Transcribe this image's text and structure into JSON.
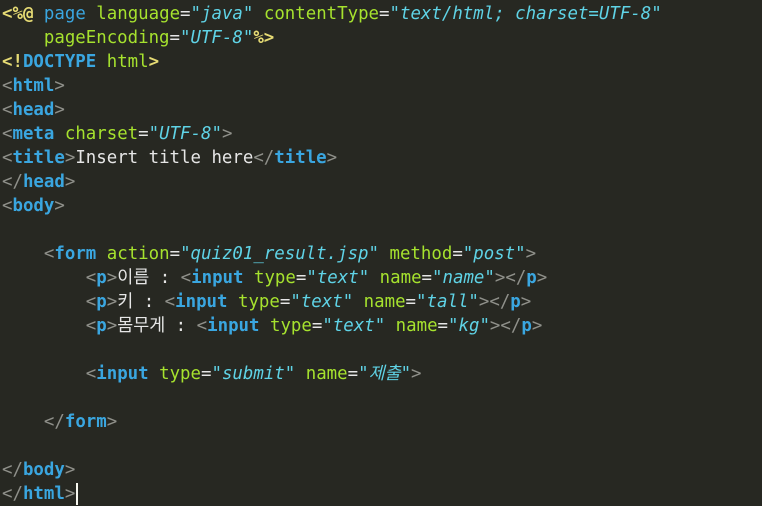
{
  "code": {
    "l1": [
      "<%@",
      " ",
      "page",
      " ",
      "language",
      "=",
      "\"java\"",
      " ",
      "contentType",
      "=",
      "\"text/html; charset=UTF-8\""
    ],
    "l2": [
      "    ",
      "pageEncoding",
      "=",
      "\"UTF-8\"",
      "%>"
    ],
    "l3": [
      "<!",
      "DOCTYPE",
      " ",
      "html",
      ">"
    ],
    "l4": [
      "<",
      "html",
      ">"
    ],
    "l5": [
      "<",
      "head",
      ">"
    ],
    "l6": [
      "<",
      "meta",
      " ",
      "charset",
      "=",
      "\"UTF-8\"",
      ">"
    ],
    "l7": [
      "<",
      "title",
      ">",
      "Insert title here",
      "</",
      "title",
      ">"
    ],
    "l8": [
      "</",
      "head",
      ">"
    ],
    "l9": [
      "<",
      "body",
      ">"
    ],
    "l11": [
      "    ",
      "<",
      "form",
      " ",
      "action",
      "=",
      "\"quiz01_result.jsp\"",
      " ",
      "method",
      "=",
      "\"post\"",
      ">"
    ],
    "l12": [
      "        ",
      "<",
      "p",
      ">",
      "이름 : ",
      "<",
      "input",
      " ",
      "type",
      "=",
      "\"text\"",
      " ",
      "name",
      "=",
      "\"name\"",
      ">",
      "</",
      "p",
      ">"
    ],
    "l13": [
      "        ",
      "<",
      "p",
      ">",
      "키 : ",
      "<",
      "input",
      " ",
      "type",
      "=",
      "\"text\"",
      " ",
      "name",
      "=",
      "\"tall\"",
      ">",
      "</",
      "p",
      ">"
    ],
    "l14": [
      "        ",
      "<",
      "p",
      ">",
      "몸무게 : ",
      "<",
      "input",
      " ",
      "type",
      "=",
      "\"text\"",
      " ",
      "name",
      "=",
      "\"kg\"",
      ">",
      "</",
      "p",
      ">"
    ],
    "l16": [
      "        ",
      "<",
      "input",
      " ",
      "type",
      "=",
      "\"submit\"",
      " ",
      "name",
      "=",
      "\"제출\"",
      ">"
    ],
    "l18": [
      "    ",
      "</",
      "form",
      ">"
    ],
    "l20": [
      "</",
      "body",
      ">"
    ],
    "l21": [
      "</",
      "html",
      ">"
    ]
  }
}
